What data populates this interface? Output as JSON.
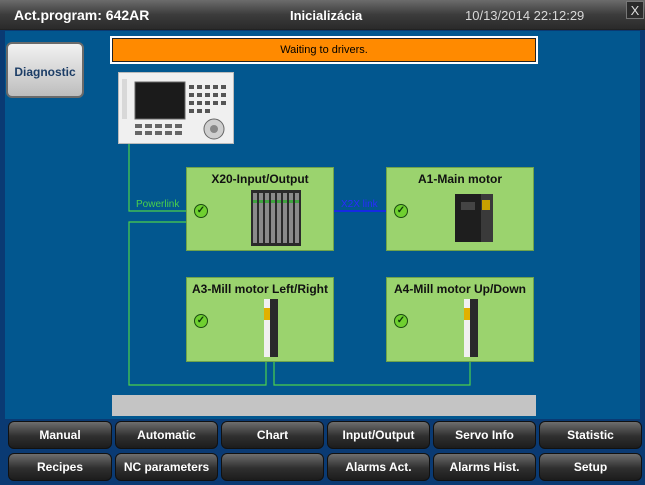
{
  "header": {
    "program": "Act.program: 642AR",
    "title": "Inicializácia",
    "datetime": "10/13/2014 22:12:29",
    "close": "X"
  },
  "sidebar": {
    "diagnostic_label": "Diagnostic"
  },
  "status_message": "Waiting to drivers.",
  "devices": {
    "io": {
      "title": "X20-Input/Output",
      "status": "ok"
    },
    "main_motor": {
      "title": "A1-Main motor",
      "status": "ok"
    },
    "mill_lr": {
      "title": "A3-Mill motor Left/Right",
      "status": "ok"
    },
    "mill_ud": {
      "title": "A4-Mill motor Up/Down",
      "status": "ok"
    }
  },
  "links": {
    "powerlink": "Powerlink",
    "x2x": "X2X link"
  },
  "colors": {
    "ok": "#6fd030",
    "status_bg": "#ff8a00",
    "powerlink": "#4bd04b",
    "x2x": "#1c1cff",
    "panel": "#02578f"
  },
  "nav": {
    "row1": [
      "Manual",
      "Automatic",
      "Chart",
      "Input/Output",
      "Servo Info",
      "Statistic"
    ],
    "row2": [
      "Recipes",
      "NC parameters",
      "",
      "Alarms Act.",
      "Alarms Hist.",
      "Setup"
    ]
  }
}
